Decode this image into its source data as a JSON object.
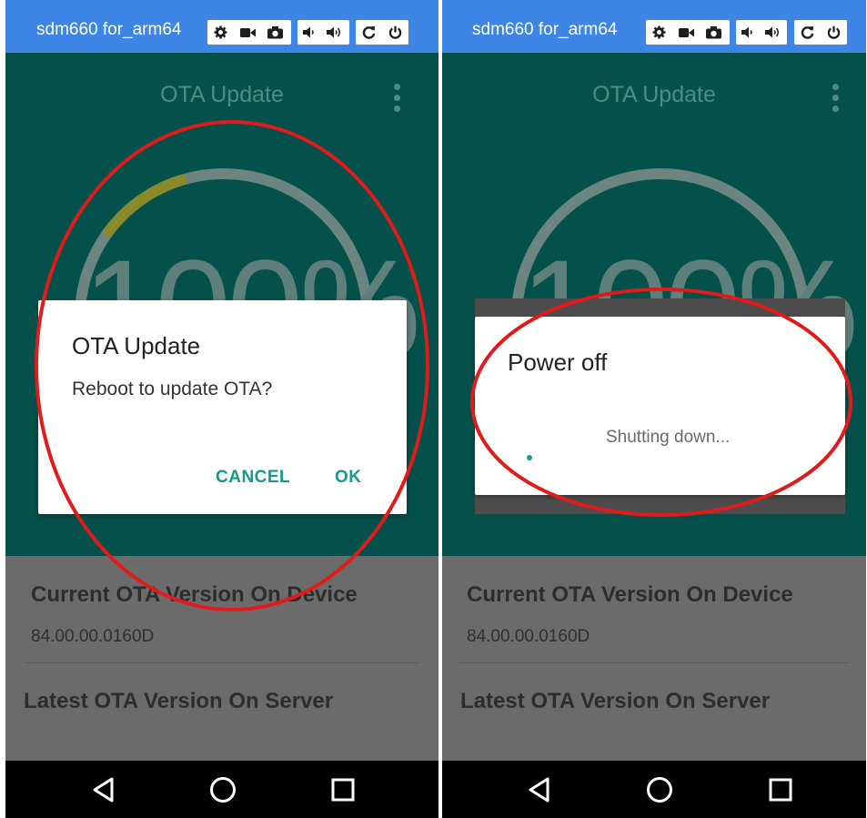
{
  "device": {
    "name": "sdm660 for_arm64"
  },
  "toolbar": {
    "icons": [
      "settings-icon",
      "video-icon",
      "camera-icon",
      "volume-down-icon",
      "volume-up-icon",
      "rotate-icon",
      "power-icon"
    ]
  },
  "app": {
    "title": "OTA Update",
    "progress_text": "100%",
    "progress_fraction": 0.1
  },
  "info": {
    "current_heading": "Current OTA Version On Device",
    "current_value": "84.00.00.0160D",
    "latest_heading": "Latest OTA Version On Server"
  },
  "dialog_update": {
    "title": "OTA Update",
    "message": "Reboot to update OTA?",
    "cancel_label": "CANCEL",
    "ok_label": "OK"
  },
  "dialog_power": {
    "title": "Power off",
    "message": "Shutting down..."
  },
  "nav": {
    "icons": [
      "back-icon",
      "home-icon",
      "recents-icon"
    ]
  },
  "colors": {
    "titlebar": "#3d86e6",
    "app_background": "#04514b",
    "accent": "#129a8a",
    "progress_arc": "#8a8a2a",
    "annotation": "#e01b1b"
  }
}
